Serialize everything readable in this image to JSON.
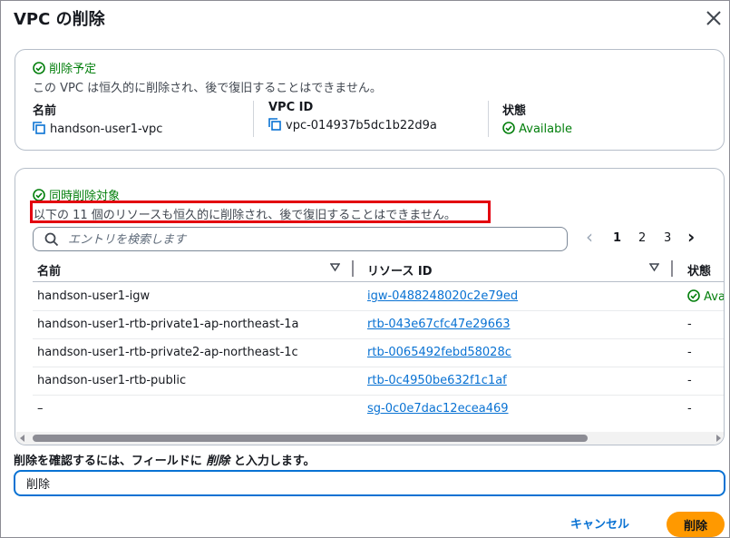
{
  "dialog": {
    "title": "VPC の削除",
    "close_icon": "close-icon"
  },
  "summary": {
    "heading": "削除予定",
    "description": "この VPC は恒久的に削除され、後で復旧することはできません。",
    "name_label": "名前",
    "name_value": "handson-user1-vpc",
    "vpcid_label": "VPC ID",
    "vpcid_value": "vpc-014937b5dc1b22d9a",
    "state_label": "状態",
    "state_value": "Available"
  },
  "related": {
    "heading": "同時削除対象",
    "description": "以下の 11 個のリソースも恒久的に削除され、後で復旧することはできません。",
    "search_placeholder": "エントリを検索します",
    "pager": {
      "prev": "‹",
      "pages": [
        "1",
        "2",
        "3"
      ],
      "current": "1",
      "next": "›"
    },
    "columns": [
      "名前",
      "リソース ID",
      "状態"
    ],
    "rows": [
      {
        "name": "handson-user1-igw",
        "id": "igw-0488248020c2e79ed",
        "state": "Ava"
      },
      {
        "name": "handson-user1-rtb-private1-ap-northeast-1a",
        "id": "rtb-043e67cfc47e29663",
        "state": "-"
      },
      {
        "name": "handson-user1-rtb-private2-ap-northeast-1c",
        "id": "rtb-0065492febd58028c",
        "state": "-"
      },
      {
        "name": "handson-user1-rtb-public",
        "id": "rtb-0c4950be632f1c1af",
        "state": "-"
      },
      {
        "name": "–",
        "id": "sg-0c0e7dac12ecea469",
        "state": "-"
      }
    ]
  },
  "confirm": {
    "label_prefix": "削除を確認するには、フィールドに ",
    "label_keyword": "削除",
    "label_suffix": " と入力します。",
    "input_value": "削除"
  },
  "footer": {
    "cancel_label": "キャンセル",
    "delete_label": "削除"
  },
  "colors": {
    "accent_blue": "#0972d3",
    "success_green": "#037f0c",
    "primary_orange": "#ff9900",
    "highlight_red": "#e3000f"
  }
}
